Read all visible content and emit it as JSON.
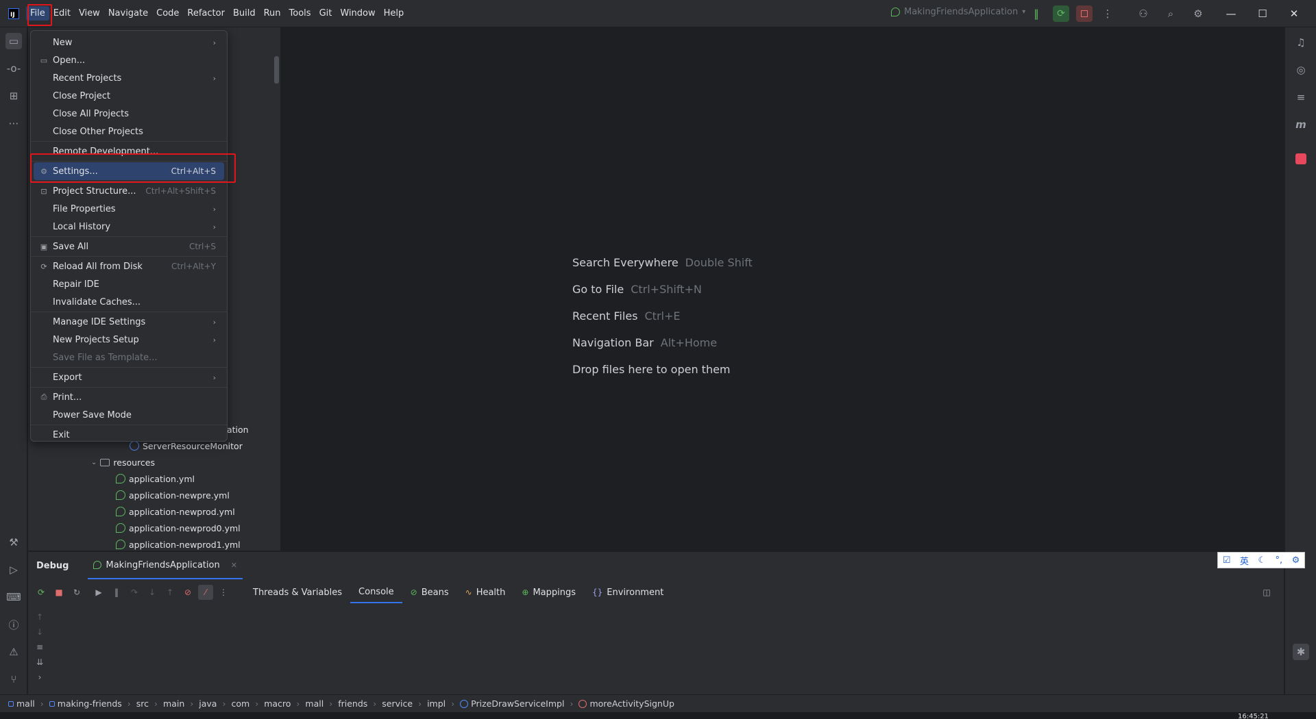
{
  "app": {
    "logo": "IJ",
    "menu": [
      "File",
      "Edit",
      "View",
      "Navigate",
      "Code",
      "Refactor",
      "Build",
      "Run",
      "Tools",
      "Git",
      "Window",
      "Help"
    ],
    "run_config": "MakingFriendsApplication",
    "run_config_icon": "spring-boot-icon"
  },
  "file_menu": {
    "items": [
      {
        "label": "New",
        "submenu": true
      },
      {
        "label": "Open...",
        "icon": "folder-icon"
      },
      {
        "label": "Recent Projects",
        "submenu": true
      },
      {
        "label": "Close Project"
      },
      {
        "label": "Close All Projects"
      },
      {
        "label": "Close Other Projects"
      },
      {
        "label": "Remote Development..."
      },
      {
        "label": "Settings...",
        "shortcut": "Ctrl+Alt+S",
        "icon": "gear-icon",
        "selected": true
      },
      {
        "label": "Project Structure...",
        "shortcut": "Ctrl+Alt+Shift+S",
        "icon": "project-structure-icon"
      },
      {
        "label": "File Properties",
        "submenu": true
      },
      {
        "label": "Local History",
        "submenu": true
      },
      {
        "label": "Save All",
        "shortcut": "Ctrl+S",
        "icon": "save-icon"
      },
      {
        "label": "Reload All from Disk",
        "shortcut": "Ctrl+Alt+Y",
        "icon": "reload-icon"
      },
      {
        "label": "Repair IDE"
      },
      {
        "label": "Invalidate Caches..."
      },
      {
        "label": "Manage IDE Settings",
        "submenu": true
      },
      {
        "label": "New Projects Setup",
        "submenu": true
      },
      {
        "label": "Save File as Template...",
        "disabled": true
      },
      {
        "label": "Export",
        "submenu": true
      },
      {
        "label": "Print...",
        "icon": "print-icon"
      },
      {
        "label": "Power Save Mode"
      },
      {
        "label": "Exit"
      }
    ]
  },
  "project_tree": {
    "partial_text": "ation",
    "rows": [
      {
        "label": "ServerResourceMonitor",
        "type": "class"
      },
      {
        "label": "resources",
        "type": "folder"
      },
      {
        "label": "application.yml",
        "type": "yml"
      },
      {
        "label": "application-newpre.yml",
        "type": "yml"
      },
      {
        "label": "application-newprod.yml",
        "type": "yml"
      },
      {
        "label": "application-newprod0.yml",
        "type": "yml"
      },
      {
        "label": "application-newprod1.yml",
        "type": "yml"
      }
    ]
  },
  "editor_hints": [
    {
      "label": "Search Everywhere",
      "key": "Double Shift"
    },
    {
      "label": "Go to File",
      "key": "Ctrl+Shift+N"
    },
    {
      "label": "Recent Files",
      "key": "Ctrl+E"
    },
    {
      "label": "Navigation Bar",
      "key": "Alt+Home"
    },
    {
      "label": "Drop files here to open them",
      "key": ""
    }
  ],
  "debug": {
    "title": "Debug",
    "run_tab": "MakingFriendsApplication",
    "tabs": [
      {
        "label": "Threads & Variables",
        "icon": ""
      },
      {
        "label": "Console",
        "icon": "",
        "active": true
      },
      {
        "label": "Beans",
        "icon": "beans-icon"
      },
      {
        "label": "Health",
        "icon": "health-icon"
      },
      {
        "label": "Mappings",
        "icon": "mappings-icon"
      },
      {
        "label": "Environment",
        "icon": "environment-icon"
      }
    ]
  },
  "ime": {
    "lang": "英"
  },
  "breadcrumbs": [
    "mall",
    "making-friends",
    "src",
    "main",
    "java",
    "com",
    "macro",
    "mall",
    "friends",
    "service",
    "impl",
    "PrizeDrawServiceImpl",
    "moreActivitySignUp"
  ],
  "clock": "16:45:21",
  "colors": {
    "accent": "#3574f0",
    "highlight": "#e2161a",
    "selected": "#2e436e"
  }
}
